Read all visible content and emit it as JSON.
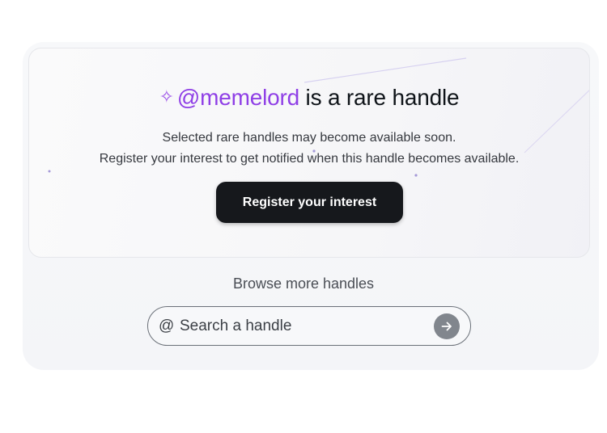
{
  "hero": {
    "sparkle_icon": "sparkle-icon",
    "handle": "@memelord",
    "headline_rest": " is a rare handle",
    "subtext_line1": "Selected rare handles may become available soon.",
    "subtext_line2": "Register your interest to get notified when this handle becomes available.",
    "cta_label": "Register your interest"
  },
  "browse": {
    "title": "Browse more handles",
    "at_prefix": "@",
    "search_placeholder": "Search a handle",
    "submit_icon": "arrow-right-icon"
  },
  "colors": {
    "handle_accent": "#8f3fe6",
    "cta_background": "#16181c",
    "submit_button": "#81868d"
  }
}
